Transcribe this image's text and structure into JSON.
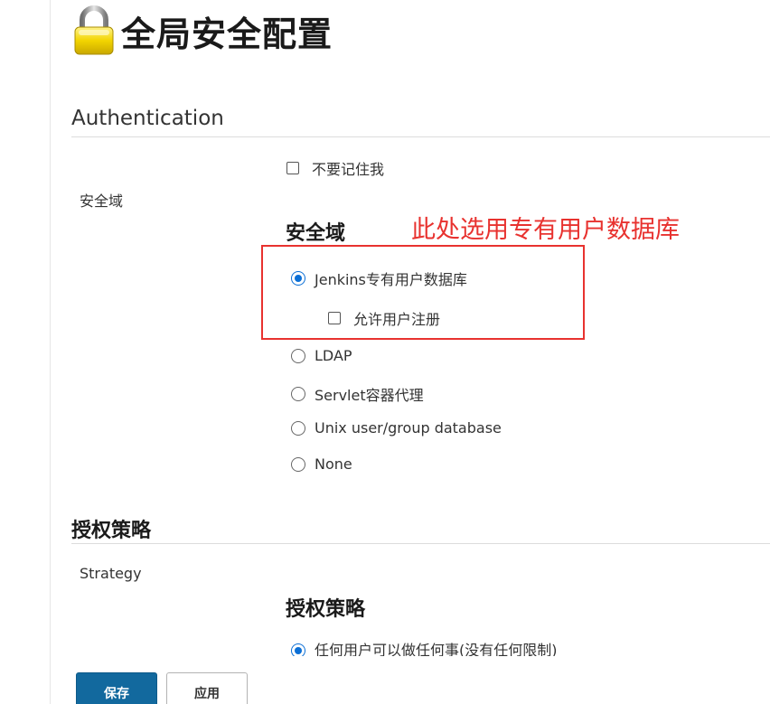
{
  "page": {
    "title": "全局安全配置",
    "icon": "lock-icon"
  },
  "authentication": {
    "section_title": "Authentication",
    "disable_remember_me_label": "不要记住我",
    "security_realm_label": "安全域",
    "security_realm_heading": "安全域",
    "realm_options": [
      {
        "label": "Jenkins专有用户数据库",
        "selected": true
      },
      {
        "label": "LDAP",
        "selected": false
      },
      {
        "label": "Servlet容器代理",
        "selected": false
      },
      {
        "label": "Unix user/group database",
        "selected": false
      },
      {
        "label": "None",
        "selected": false
      }
    ],
    "allow_signup_label": "允许用户注册",
    "annotation": "此处选用专有用户数据库",
    "annotation_color": "#e8322f"
  },
  "authorization": {
    "section_title": "授权策略",
    "strategy_label": "Strategy",
    "strategy_heading": "授权策略",
    "strategy_options": [
      {
        "label": "任何用户可以做任何事(没有任何限制)",
        "selected": true
      }
    ]
  },
  "buttons": {
    "save": "保存",
    "apply": "应用"
  },
  "colors": {
    "accent": "#0b6fd6",
    "primary_button": "#12699e"
  }
}
